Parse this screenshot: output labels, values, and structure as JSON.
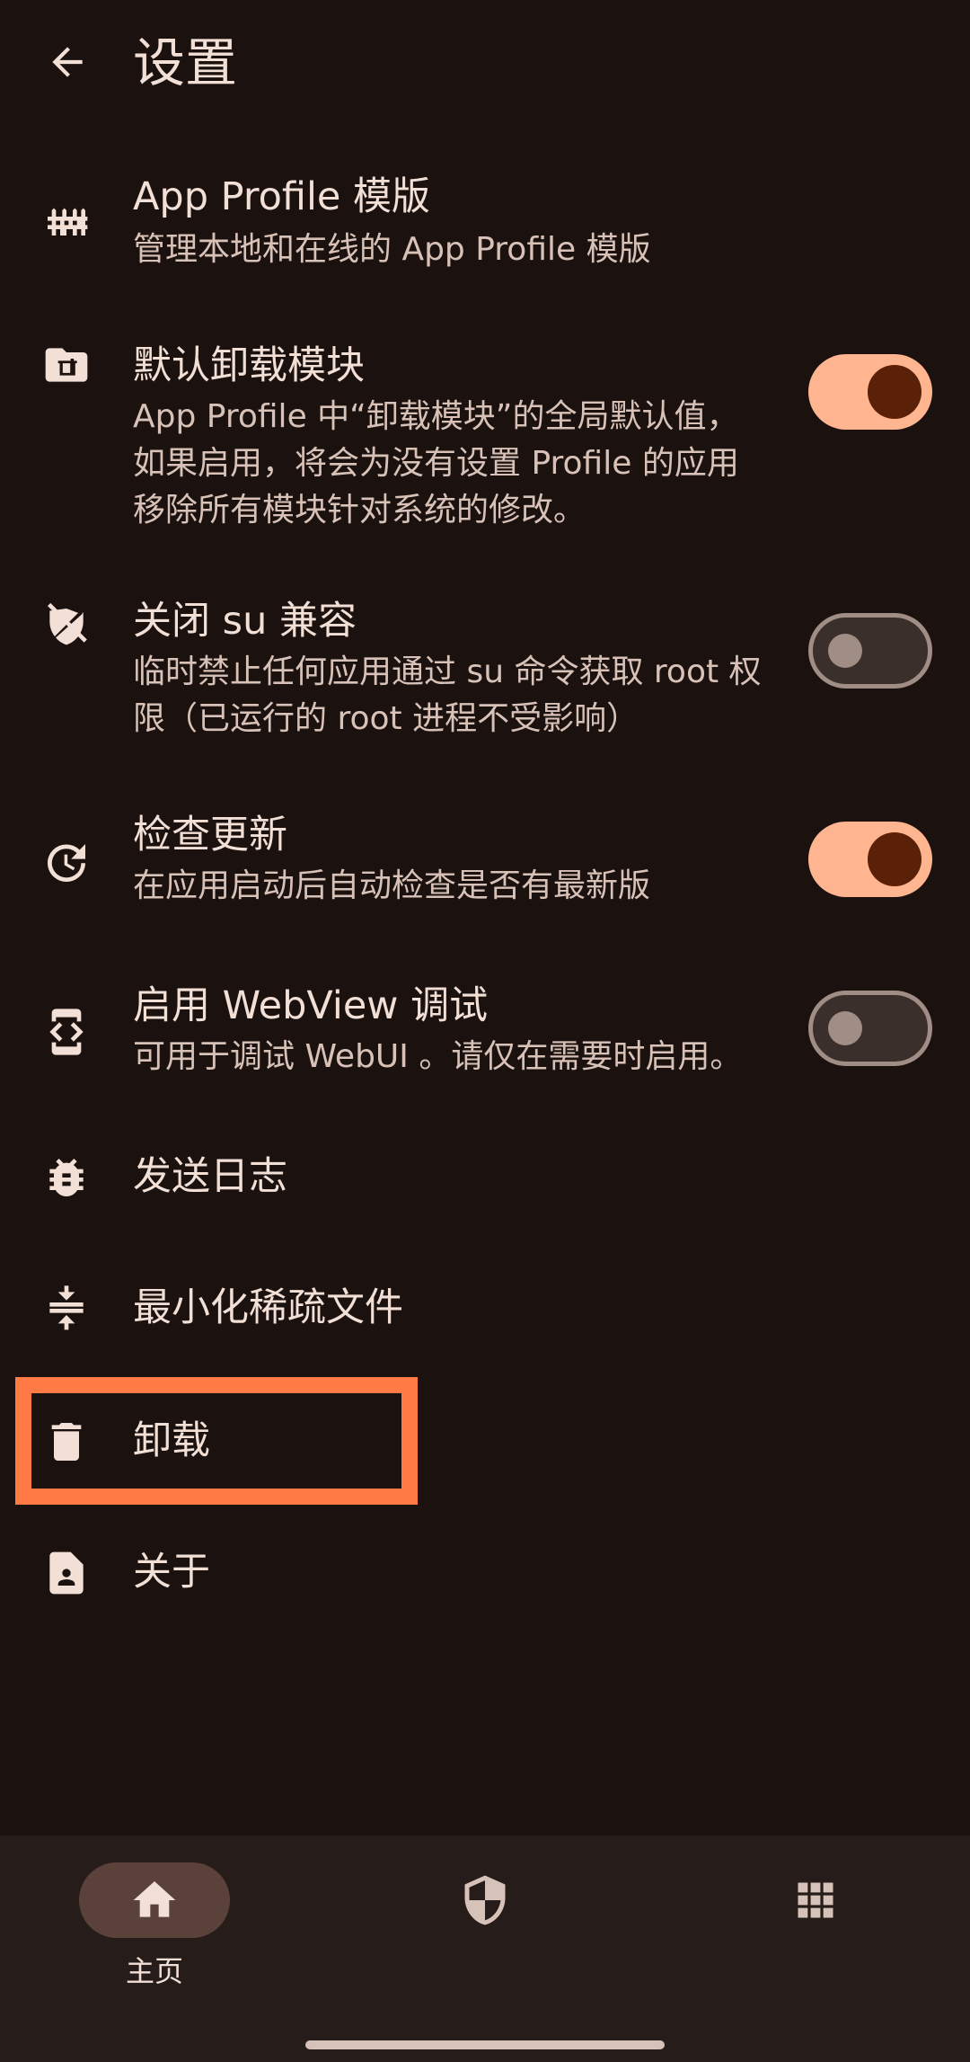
{
  "header": {
    "title": "设置"
  },
  "settings": [
    {
      "title": "App Profile 模版",
      "desc": "管理本地和在线的 App Profile 模版"
    },
    {
      "title": "默认卸载模块",
      "desc": "App Profile 中“卸载模块”的全局默认值，如果启用，将会为没有设置 Profile 的应用移除所有模块针对系统的修改。",
      "toggle": true
    },
    {
      "title": "关闭 su 兼容",
      "desc": "临时禁止任何应用通过 su 命令获取 root 权限（已运行的 root 进程不受影响）",
      "toggle": false
    },
    {
      "title": "检查更新",
      "desc": "在应用启动后自动检查是否有最新版",
      "toggle": true
    },
    {
      "title": "启用 WebView 调试",
      "desc": "可用于调试 WebUI 。请仅在需要时启用。",
      "toggle": false
    },
    {
      "title": "发送日志"
    },
    {
      "title": "最小化稀疏文件"
    },
    {
      "title": "卸载"
    },
    {
      "title": "关于"
    }
  ],
  "bottom_nav": [
    {
      "label": "主页",
      "icon": "home-icon",
      "active": true
    },
    {
      "label": "",
      "icon": "shield-icon",
      "active": false
    },
    {
      "label": "",
      "icon": "apps-grid-icon",
      "active": false
    }
  ],
  "colors": {
    "accent": "#ffb690",
    "highlight": "#ff7a45",
    "background": "#1b1210"
  }
}
